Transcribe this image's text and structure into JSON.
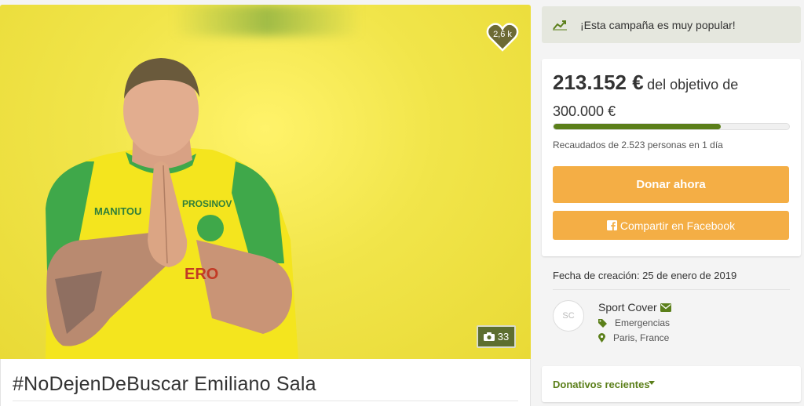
{
  "campaign": {
    "title": "#NoDejenDeBuscar Emiliano Sala",
    "likes": "2,6 k",
    "photo_count": "33"
  },
  "popular": {
    "text": "¡Esta campaña es muy popular!",
    "icon": "trend-up-icon"
  },
  "funding": {
    "raised": "213.152 €",
    "of_label": "del objetivo de",
    "goal": "300.000 €",
    "progress_fraction": 0.71,
    "note": "Recaudados de 2.523 personas en 1 día"
  },
  "actions": {
    "donate_label": "Donar ahora",
    "share_label": "Compartir en Facebook"
  },
  "details": {
    "created": "Fecha de creación: 25 de enero de 2019",
    "avatar_initials": "SC",
    "organizer": "Sport Cover",
    "category": "Emergencias",
    "location": "Paris, France"
  },
  "recent": {
    "label": "Donativos recientes"
  },
  "colors": {
    "accent_orange": "#f4ae45",
    "accent_green": "#5b7f1a",
    "badge_olive": "#5d6e2f"
  }
}
